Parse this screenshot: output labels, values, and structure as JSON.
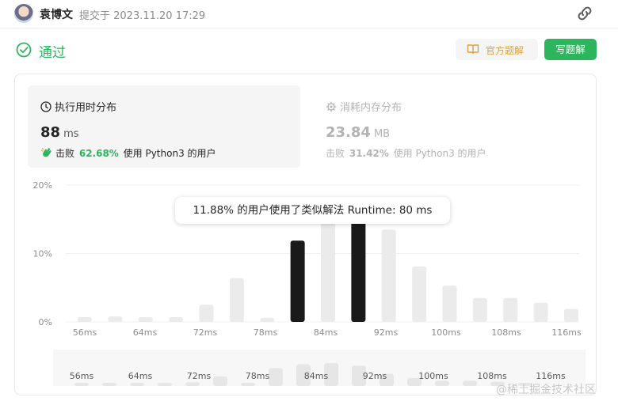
{
  "header": {
    "author": "袁博文",
    "submitted": "提交于 2023.11.20 17:29"
  },
  "status": {
    "text": "通过",
    "official_solution_label": "官方题解",
    "write_solution_label": "写题解"
  },
  "stats": {
    "runtime": {
      "title": "执行用时分布",
      "value": "88",
      "unit": "ms",
      "beat_prefix": "击败",
      "beat_pct": "62.68%",
      "beat_suffix": "使用 Python3 的用户"
    },
    "memory": {
      "title": "消耗内存分布",
      "value": "23.84",
      "unit": "MB",
      "beat_prefix": "击败",
      "beat_pct": "31.42%",
      "beat_suffix": "使用 Python3 的用户"
    }
  },
  "tooltip": "11.88% 的用户使用了类似解法 Runtime: 80 ms",
  "chart_data": {
    "type": "bar",
    "xlabel": "",
    "ylabel": "",
    "ylim": [
      0,
      20
    ],
    "y_ticks": [
      "0%",
      "10%",
      "20%"
    ],
    "x_tick_labels": [
      "56ms",
      "64ms",
      "72ms",
      "78ms",
      "84ms",
      "92ms",
      "100ms",
      "108ms",
      "116ms"
    ],
    "categories": [
      "56",
      "60",
      "64",
      "68",
      "72",
      "76",
      "78",
      "80",
      "84",
      "88",
      "92",
      "96",
      "100",
      "104",
      "108",
      "112",
      "116"
    ],
    "values": [
      0.7,
      0.8,
      0.7,
      0.7,
      2.5,
      6.4,
      0.6,
      11.88,
      14.5,
      15.2,
      13.5,
      8.1,
      5.3,
      3.5,
      3.5,
      2.8,
      1.9
    ],
    "highlighted": [
      "80",
      "88"
    ],
    "colors": {
      "bar": "#ebebeb",
      "highlight": "#1a1a1a",
      "grid": "#f0f0f0",
      "tick": "#8c8c8c"
    },
    "overview_tick_labels": [
      "56ms",
      "64ms",
      "72ms",
      "78ms",
      "84ms",
      "92ms",
      "100ms",
      "108ms",
      "116ms"
    ]
  },
  "watermark": "@稀土掘金技术社区"
}
